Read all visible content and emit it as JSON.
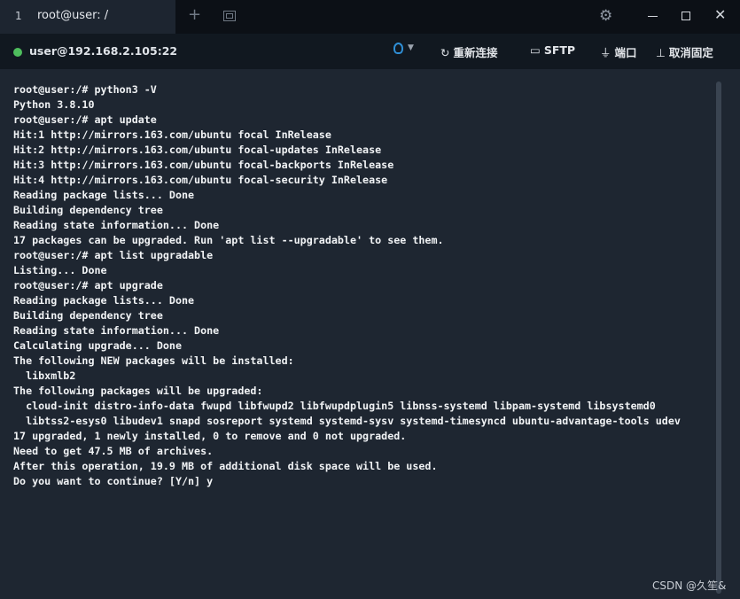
{
  "tab": {
    "index": "1",
    "title": "root@user: /",
    "close_symbol": "✕",
    "active_color": "#1d2530"
  },
  "titlebar_controls": {
    "new_tab_symbol": "+",
    "settings_icon": "gear-icon",
    "minimize_icon": "minimize-icon",
    "maximize_icon": "maximize-icon",
    "close_symbol": "✕"
  },
  "toolbar": {
    "status_color": "#4ebe5d",
    "host": "user@192.168.2.105:22",
    "bulb_icon": "lightbulb-icon",
    "reconnect_label": "重新连接",
    "sftp_label": "SFTP",
    "port_label": "端口",
    "unpin_label": "取消固定"
  },
  "terminal": {
    "background": "#1e2631",
    "lines": [
      "root@user:/# python3 -V",
      "Python 3.8.10",
      "root@user:/# apt update",
      "Hit:1 http://mirrors.163.com/ubuntu focal InRelease",
      "Hit:2 http://mirrors.163.com/ubuntu focal-updates InRelease",
      "Hit:3 http://mirrors.163.com/ubuntu focal-backports InRelease",
      "Hit:4 http://mirrors.163.com/ubuntu focal-security InRelease",
      "Reading package lists... Done",
      "Building dependency tree",
      "Reading state information... Done",
      "17 packages can be upgraded. Run 'apt list --upgradable' to see them.",
      "root@user:/# apt list upgradable",
      "Listing... Done",
      "root@user:/# apt upgrade",
      "Reading package lists... Done",
      "Building dependency tree",
      "Reading state information... Done",
      "Calculating upgrade... Done",
      "The following NEW packages will be installed:",
      "  libxmlb2",
      "The following packages will be upgraded:",
      "  cloud-init distro-info-data fwupd libfwupd2 libfwupdplugin5 libnss-systemd libpam-systemd libsystemd0",
      "  libtss2-esys0 libudev1 snapd sosreport systemd systemd-sysv systemd-timesyncd ubuntu-advantage-tools udev",
      "17 upgraded, 1 newly installed, 0 to remove and 0 not upgraded.",
      "Need to get 47.5 MB of archives.",
      "After this operation, 19.9 MB of additional disk space will be used.",
      "Do you want to continue? [Y/n] y"
    ]
  },
  "watermark": "CSDN @久笙&"
}
